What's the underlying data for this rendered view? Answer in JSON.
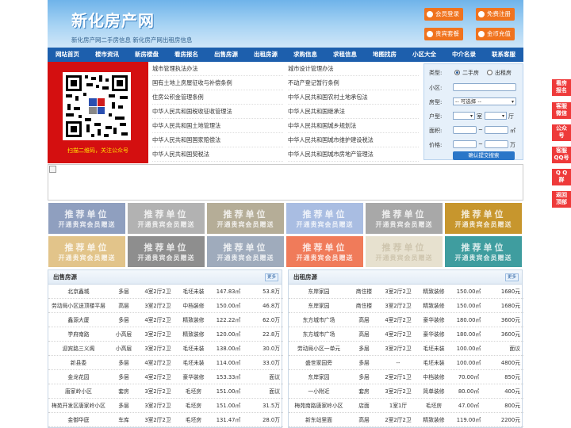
{
  "header": {
    "title": "新化房产网",
    "desc": "新化房产网二手房信息 新化房产网出租房信息",
    "buttons": [
      "会员登录",
      "免费注册",
      "贵宾套餐",
      "金币充值"
    ]
  },
  "nav": [
    "网站首页",
    "楼市资讯",
    "新房楼盘",
    "看房报名",
    "出售房源",
    "出租房源",
    "求购信息",
    "求租信息",
    "地图找房",
    "小区大全",
    "中介名录",
    "联系客服"
  ],
  "qr_caption": "扫描二维码，关注公众号",
  "links_left": [
    "城市管理执法办法",
    "国有土地上房屋征收与补偿条例",
    "住房公积金管理条例",
    "中华人民共和国税收征收管理法",
    "中华人民共和国土地管理法",
    "中华人民共和国国家赔偿法",
    "中华人民共和国契税法"
  ],
  "links_right": [
    "城市设计管理办法",
    "不动产登记暂行条例",
    "中华人民共和国农村土地承包法",
    "中华人民共和国继承法",
    "中华人民共和国城乡规划法",
    "中华人民共和国城市维护建设税法",
    "中华人民共和国城市房地产管理法"
  ],
  "search": {
    "type_label": "类型:",
    "opt1": "二手房",
    "opt2": "出租房",
    "community_label": "小区:",
    "room_label": "房型:",
    "room_select": "-- 可选择 --",
    "layout_label": "户型:",
    "shi": "室",
    "ting": "厅",
    "area_label": "面积:",
    "area_unit": "㎡",
    "price_label": "价格:",
    "price_unit": "万",
    "submit": "确认提交搜索"
  },
  "recommend": {
    "title": "推荐单位",
    "sub": "开通贵宾会员赠送",
    "colors": [
      "#8f9fbf",
      "#b2b2b2",
      "#b5ad97",
      "#a9bde2",
      "#a8a8a8",
      "#c7962d",
      "#e2c48a",
      "#8e8e8e",
      "#9fabbc",
      "#f07b5a",
      "#e7e1cf",
      "#3f9d9f"
    ]
  },
  "sale": {
    "title": "出售房源",
    "more": "更多",
    "rows": [
      [
        "北京鑫城",
        "多层",
        "4室2厅2卫",
        "毛坯未装",
        "147.83㎡",
        "53.8万"
      ],
      [
        "劳动局小区送顶楼平层",
        "高层",
        "3室2厅2卫",
        "中档装修",
        "150.00㎡",
        "46.8万"
      ],
      [
        "鑫源大厦",
        "多层",
        "4室2厅2卫",
        "精致装修",
        "122.22㎡",
        "62.0万"
      ],
      [
        "学府南路",
        "小高层",
        "3室2厅2卫",
        "精致装修",
        "120.00㎡",
        "22.8万"
      ],
      [
        "迎宾路三义阁",
        "小高层",
        "3室2厅2卫",
        "毛坯未装",
        "138.00㎡",
        "30.0万"
      ],
      [
        "新县委",
        "多层",
        "4室2厅2卫",
        "毛坯未装",
        "114.00㎡",
        "33.0万"
      ],
      [
        "金龙花园",
        "多层",
        "4室2厅2卫",
        "豪华装修",
        "153.33㎡",
        "面议"
      ],
      [
        "唐家岭小区",
        "套房",
        "3室2厅2卫",
        "毛坯房",
        "151.00㎡",
        "面议"
      ],
      [
        "梅苑开发区唐家岭小区",
        "多层",
        "3室2厅2卫",
        "毛坯房",
        "151.00㎡",
        "31.5万"
      ],
      [
        "金御华庭",
        "车库",
        "3室2厅2卫",
        "毛坯房",
        "131.47㎡",
        "28.0万"
      ]
    ]
  },
  "rent": {
    "title": "出租房源",
    "more": "更多",
    "rows": [
      [
        "东岸家园",
        "商住楼",
        "3室2厅2卫",
        "精致装修",
        "150.00㎡",
        "1680元"
      ],
      [
        "东岸家园",
        "商住楼",
        "3室2厅2卫",
        "精致装修",
        "150.00㎡",
        "1680元"
      ],
      [
        "东方城市广场",
        "高层",
        "4室2厅2卫",
        "豪华装修",
        "180.00㎡",
        "3600元"
      ],
      [
        "东方城市广场",
        "高层",
        "4室2厅2卫",
        "豪华装修",
        "180.00㎡",
        "3600元"
      ],
      [
        "劳动局小区一单元",
        "多层",
        "3室2厅2卫",
        "毛坯未装",
        "100.00㎡",
        "面议"
      ],
      [
        "盛世家园旁",
        "多层",
        "--",
        "毛坯未装",
        "100.00㎡",
        "4800元"
      ],
      [
        "东岸家园",
        "多层",
        "2室2厅1卫",
        "中档装修",
        "70.00㎡",
        "850元"
      ],
      [
        "一小附近",
        "套房",
        "3室2厅2卫",
        "简单装修",
        "80.00㎡",
        "400元"
      ],
      [
        "梅苑南路唐家岭小区",
        "店面",
        "1室1厅",
        "毛坯房",
        "47.00㎡",
        "800元"
      ],
      [
        "新东站里面",
        "高层",
        "2室2厅2卫",
        "精致装修",
        "119.00㎡",
        "2200元"
      ]
    ]
  },
  "side": [
    [
      "看房",
      "报名"
    ],
    [
      "客服",
      "微信"
    ],
    [
      "公众",
      "号"
    ],
    [
      "客服",
      "QQ号"
    ],
    [
      "Q Q",
      "群"
    ],
    [
      "返回",
      "顶部"
    ]
  ]
}
